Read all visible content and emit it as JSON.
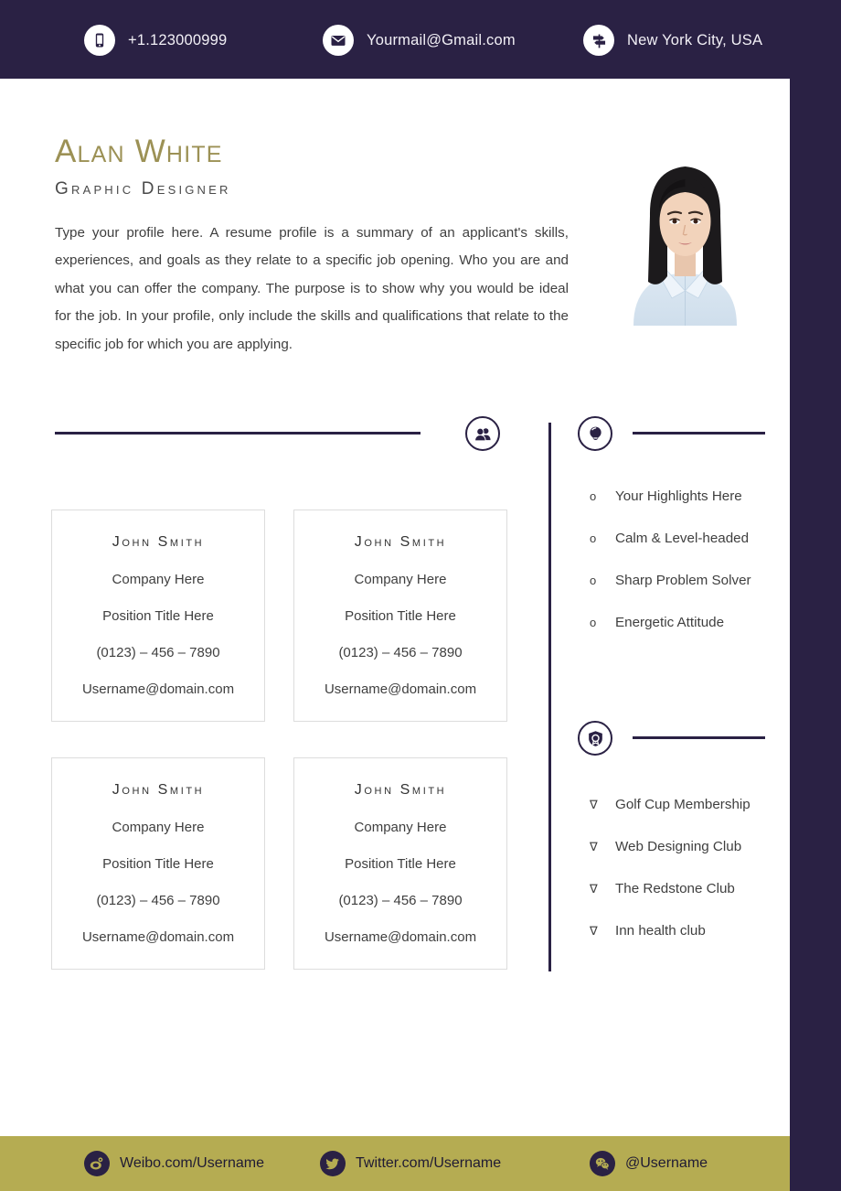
{
  "theme": {
    "dark_purple": "#2a2144",
    "gold": "#b5ac52",
    "name_gold": "#9c9155",
    "body_text": "#3f3f3f",
    "card_border": "#dddddd"
  },
  "topbar": {
    "contacts": [
      {
        "icon": "mobile-phone-icon",
        "text": "+1.123000999"
      },
      {
        "icon": "envelope-icon",
        "text": "Yourmail@Gmail.com"
      },
      {
        "icon": "signpost-icon",
        "text": "New York City, USA"
      }
    ]
  },
  "identity": {
    "name": "Alan White",
    "job_title": "Graphic Designer",
    "profile": "Type your profile here. A resume profile is a summary of an applicant's skills, experiences, and goals as they relate to a specific job opening. Who you are and what you can offer the company. The purpose is to show why you would be ideal for the job. In your profile, only include the skills and qualifications that relate to the specific job for which you are applying.",
    "portrait_alt": "portrait-photo"
  },
  "sections": {
    "references": {
      "icon": "two-people-icon"
    },
    "highlights": {
      "icon": "lightbulb-icon"
    },
    "memberships": {
      "icon": "shield-award-icon"
    }
  },
  "references": [
    {
      "name": "John Smith",
      "company": "Company Here",
      "position": "Position Title Here",
      "phone": "(0123) – 456 – 7890",
      "email": "Username@domain.com"
    },
    {
      "name": "John Smith",
      "company": "Company Here",
      "position": "Position Title Here",
      "phone": "(0123) – 456 – 7890",
      "email": "Username@domain.com"
    },
    {
      "name": "John Smith",
      "company": "Company Here",
      "position": "Position Title Here",
      "phone": "(0123) – 456 – 7890",
      "email": "Username@domain.com"
    },
    {
      "name": "John Smith",
      "company": "Company Here",
      "position": "Position Title Here",
      "phone": "(0123) – 456 – 7890",
      "email": "Username@domain.com"
    }
  ],
  "highlights": {
    "marker": "o",
    "items": [
      "Your Highlights Here",
      "Calm & Level-headed",
      "Sharp Problem Solver",
      "Energetic Attitude"
    ]
  },
  "memberships": {
    "marker": "∇",
    "items": [
      "Golf Cup Membership",
      "Web Designing Club",
      "The Redstone Club",
      "Inn health club"
    ]
  },
  "footer": {
    "socials": [
      {
        "icon": "weibo-icon",
        "text": "Weibo.com/Username"
      },
      {
        "icon": "twitter-icon",
        "text": "Twitter.com/Username"
      },
      {
        "icon": "wechat-icon",
        "text": "@Username"
      }
    ]
  }
}
